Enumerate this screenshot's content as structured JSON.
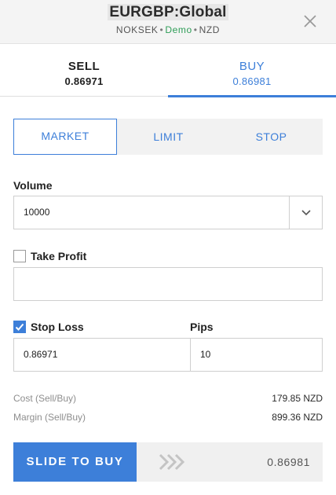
{
  "header": {
    "title": "EURGBP:Global",
    "account": "NOKSEK",
    "mode": "Demo",
    "currency": "NZD",
    "separator": "•",
    "close_icon": "close-icon"
  },
  "sides": {
    "sell": {
      "label": "SELL",
      "price": "0.86971"
    },
    "buy": {
      "label": "BUY",
      "price": "0.86981"
    },
    "selected": "buy"
  },
  "order_types": {
    "market": "MARKET",
    "limit": "LIMIT",
    "stop": "STOP",
    "selected": "market"
  },
  "volume": {
    "label": "Volume",
    "value": "10000",
    "dropdown_icon": "chevron-down-icon"
  },
  "take_profit": {
    "label": "Take Profit",
    "checked": false,
    "value": ""
  },
  "stop_loss": {
    "label": "Stop Loss",
    "checked": true,
    "value": "0.86971"
  },
  "pips": {
    "label": "Pips",
    "value": "10"
  },
  "summary": {
    "cost_label": "Cost (Sell/Buy)",
    "cost_value": "179.85 NZD",
    "margin_label": "Margin (Sell/Buy)",
    "margin_value": "899.36 NZD"
  },
  "slide": {
    "label": "SLIDE TO BUY",
    "price": "0.86981",
    "icon": "double-chevron-right-icon"
  },
  "colors": {
    "accent": "#3d7fd9",
    "demo": "#2e9d57"
  }
}
